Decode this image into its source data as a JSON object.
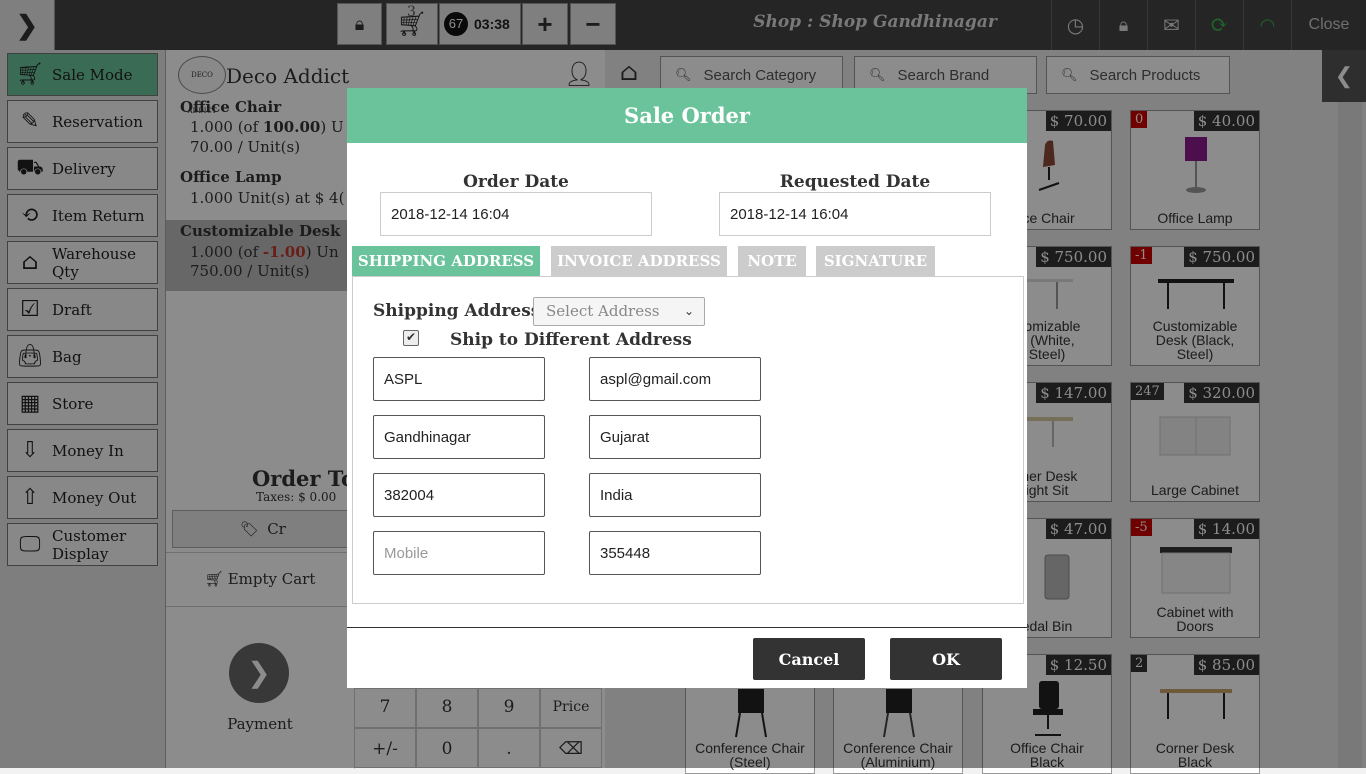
{
  "topbar": {
    "cart_count": "3",
    "badge_number": "67",
    "clock": "03:38",
    "plus_label": "+",
    "minus_label": "−",
    "shop_title": "Shop : Shop Gandhinagar",
    "close_label": "Close"
  },
  "sidebar": {
    "items": [
      {
        "label": "Sale Mode",
        "icon": "truck-icon"
      },
      {
        "label": "Reservation",
        "icon": "reservation-icon"
      },
      {
        "label": "Delivery",
        "icon": "delivery-truck-icon"
      },
      {
        "label": "Item Return",
        "icon": "return-bag-icon"
      },
      {
        "label": "Warehouse Qty",
        "icon": "warehouse-icon"
      },
      {
        "label": "Draft",
        "icon": "draft-icon"
      },
      {
        "label": "Bag",
        "icon": "bag-icon"
      },
      {
        "label": "Store",
        "icon": "store-icon"
      },
      {
        "label": "Money In",
        "icon": "money-in-icon"
      },
      {
        "label": "Money Out",
        "icon": "money-out-icon"
      },
      {
        "label": "Customer Display",
        "icon": "monitor-icon"
      }
    ]
  },
  "cart": {
    "customer": "Deco Addict",
    "logo_text": "DECO ADDICT",
    "lines": [
      {
        "name": "Office Chair",
        "qty_prefix": "1.000 (of ",
        "qty_of": "100.00",
        "qty_suffix": ") U",
        "unit": "70.00 / Unit(s)"
      },
      {
        "name": "Office Lamp",
        "detail": "1.000 Unit(s) at $ 4("
      },
      {
        "name": "Customizable Desk (I",
        "qty_prefix": "1.000 (of ",
        "qty_of": "-1.00",
        "qty_suffix": ") Un",
        "unit": "750.00 / Unit(s)"
      }
    ],
    "order_total_label": "Order To",
    "taxes": "Taxes: $ 0.00",
    "credit_label": "Cr",
    "empty_cart": "Empty Cart",
    "payment": "Payment",
    "keypad": [
      "7",
      "8",
      "9",
      "Price",
      "+/-",
      "0",
      ".",
      "⌫"
    ]
  },
  "products": {
    "search_category": "Search Category",
    "search_brand": "Search Brand",
    "search_products": "Search Products",
    "cards": [
      {
        "name": "ice Chair",
        "price": "$ 70.00",
        "qty": ""
      },
      {
        "name": "Office Lamp",
        "price": "$ 40.00",
        "qty": "0"
      },
      {
        "name": "stomizable\nk (White,\nSteel)",
        "price": "$ 750.00",
        "qty": ""
      },
      {
        "name": "Customizable\nDesk (Black,\nSteel)",
        "price": "$ 750.00",
        "qty": "-1"
      },
      {
        "name": "rner Desk\night Sit",
        "price": "$ 147.00",
        "qty": ""
      },
      {
        "name": "Large Cabinet",
        "price": "$ 320.00",
        "qty": "247"
      },
      {
        "name": "edal Bin",
        "price": "$ 47.00",
        "qty": ""
      },
      {
        "name": "Cabinet with\nDoors",
        "price": "$ 14.00",
        "qty": "-5"
      },
      {
        "name": "Conference Chair\n(Steel)",
        "price": "",
        "qty": ""
      },
      {
        "name": "Conference Chair\n(Aluminium)",
        "price": "",
        "qty": ""
      },
      {
        "name": "Office Chair\nBlack",
        "price": "$ 12.50",
        "qty": ""
      },
      {
        "name": "Corner Desk\nBlack",
        "price": "$ 85.00",
        "qty": "2"
      }
    ]
  },
  "modal": {
    "title": "Sale Order",
    "order_date_label": "Order Date",
    "order_date": "2018-12-14 16:04",
    "requested_date_label": "Requested Date",
    "requested_date": "2018-12-14 16:04",
    "tabs": [
      "SHIPPING ADDRESS",
      "INVOICE ADDRESS",
      "NOTE",
      "SIGNATURE"
    ],
    "shipping_address_label": "Shipping Address",
    "select_address": "Select Address",
    "ship_different_label": "Ship to Different Address",
    "fields": {
      "name": "ASPL",
      "email": "aspl@gmail.com",
      "city": "Gandhinagar",
      "state": "Gujarat",
      "zip": "382004",
      "country": "India",
      "mobile_placeholder": "Mobile",
      "phone": "355448"
    },
    "cancel": "Cancel",
    "ok": "OK"
  }
}
